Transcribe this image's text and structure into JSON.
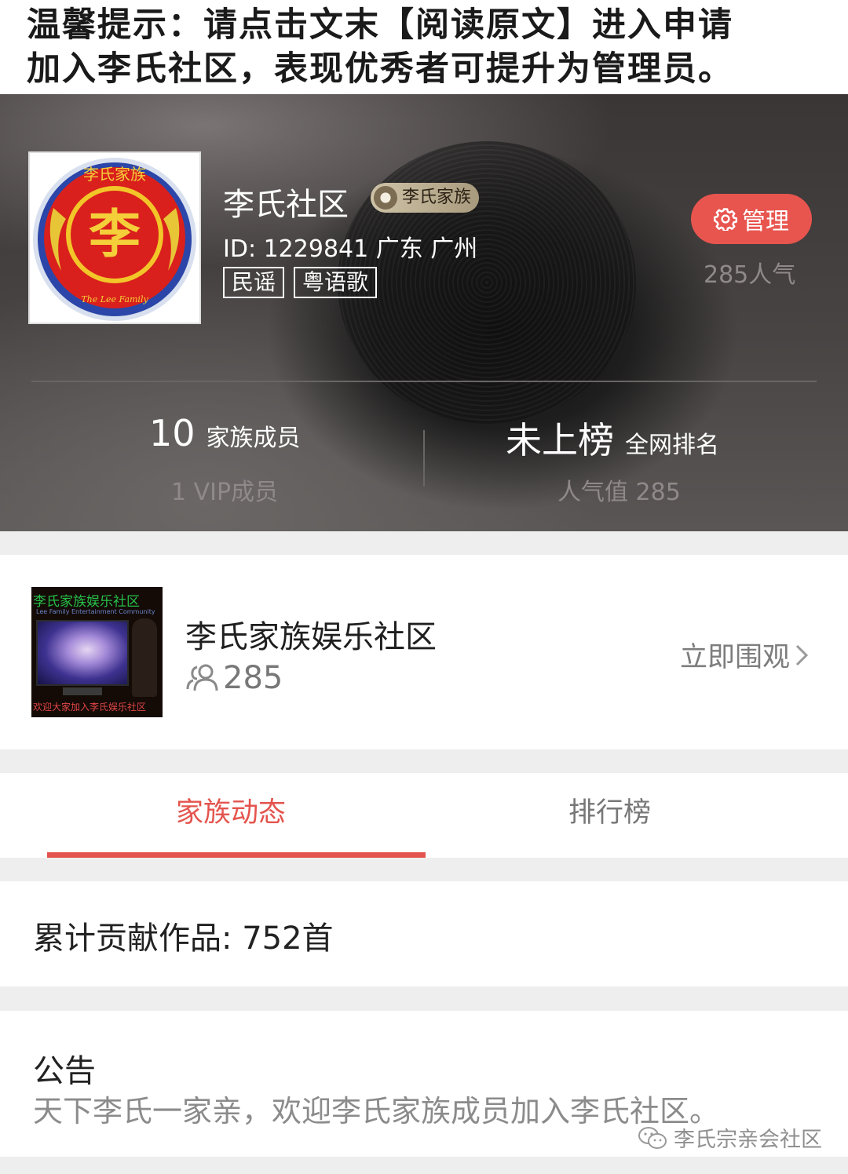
{
  "notice": {
    "line1": "温馨提示：请点击文末【阅读原文】进入申请",
    "line2": "加入李氏社区，表现优秀者可提升为管理员。"
  },
  "header": {
    "group_name": "李氏社区",
    "family_badge": "李氏家族",
    "id_location": "ID: 1229841 广东 广州",
    "tags": [
      "民谣",
      "粤语歌"
    ],
    "manage_label": "管理",
    "popularity": "285人气",
    "logo_character": "李",
    "logo_top_text": "李氏家族",
    "logo_bottom_text": "The Lee Family"
  },
  "stats": {
    "members_count": "10",
    "members_label": "家族成员",
    "vip_line": "1 VIP成员",
    "rank_value": "未上榜",
    "rank_label": "全网排名",
    "popularity_line": "人气值 285"
  },
  "community": {
    "name": "李氏家族娱乐社区",
    "count": "285",
    "watch_label": "立即围观",
    "thumb_top": "李氏家族娱乐社区",
    "thumb_sub": "Lee Family Entertainment Community",
    "thumb_bottom": "欢迎大家加入李氏娱乐社区"
  },
  "tabs": {
    "active": "家族动态",
    "rank": "排行榜"
  },
  "contribution": {
    "text": "累计贡献作品: 752首"
  },
  "announcement": {
    "title": "公告",
    "body": "天下李氏一家亲，欢迎李氏家族成员加入李氏社区。"
  },
  "watermark": {
    "text": "李氏宗亲会社区"
  },
  "colors": {
    "accent": "#e4544e",
    "manage_button": "#e8554f",
    "muted_text": "#8b8b8b",
    "page_bg": "#eeeeee"
  },
  "icons": {
    "manage": "gear-icon",
    "members": "people-icon",
    "watch": "chevron-right-icon",
    "watermark": "wechat-icon"
  }
}
